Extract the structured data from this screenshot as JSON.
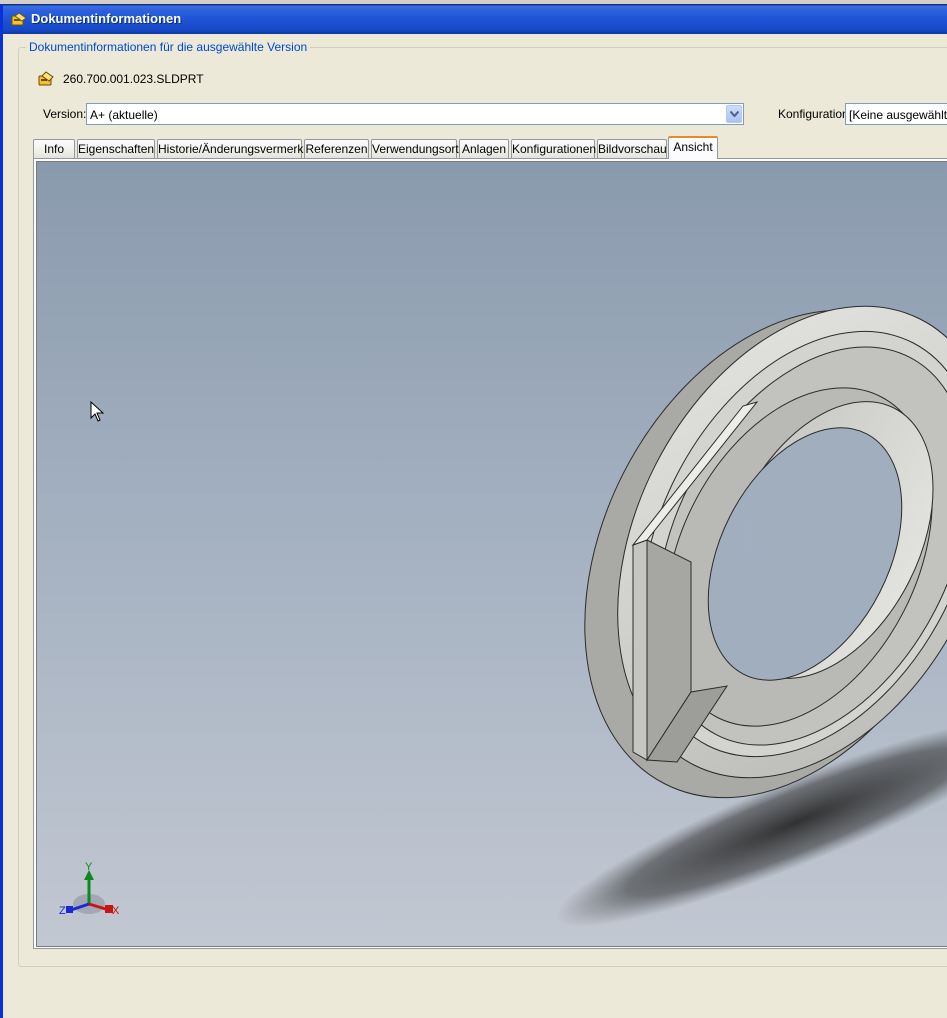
{
  "window": {
    "title": "Dokumentinformationen"
  },
  "group": {
    "legend": "Dokumentinformationen für die ausgewählte Version"
  },
  "document": {
    "filename": "260.700.001.023.SLDPRT",
    "icon": "part-icon"
  },
  "version": {
    "label": "Version:",
    "value": "A+ (aktuelle)"
  },
  "configuration": {
    "label": "Konfiguration:",
    "value": "[Keine ausgewählt]"
  },
  "tabs": [
    {
      "label": "Info"
    },
    {
      "label": "Eigenschaften"
    },
    {
      "label": "Historie/Änderungsvermerke"
    },
    {
      "label": "Referenzen"
    },
    {
      "label": "Verwendungsort"
    },
    {
      "label": "Anlagen"
    },
    {
      "label": "Konfigurationen"
    },
    {
      "label": "Bildvorschau"
    },
    {
      "label": "Ansicht"
    }
  ],
  "active_tab": "Ansicht",
  "triad": {
    "x_label": "X",
    "y_label": "Y",
    "z_label": "Z"
  },
  "colors": {
    "title_bar": "#1e54d6",
    "legend_text": "#0046d5",
    "active_tab_accent": "#e68b2c"
  }
}
